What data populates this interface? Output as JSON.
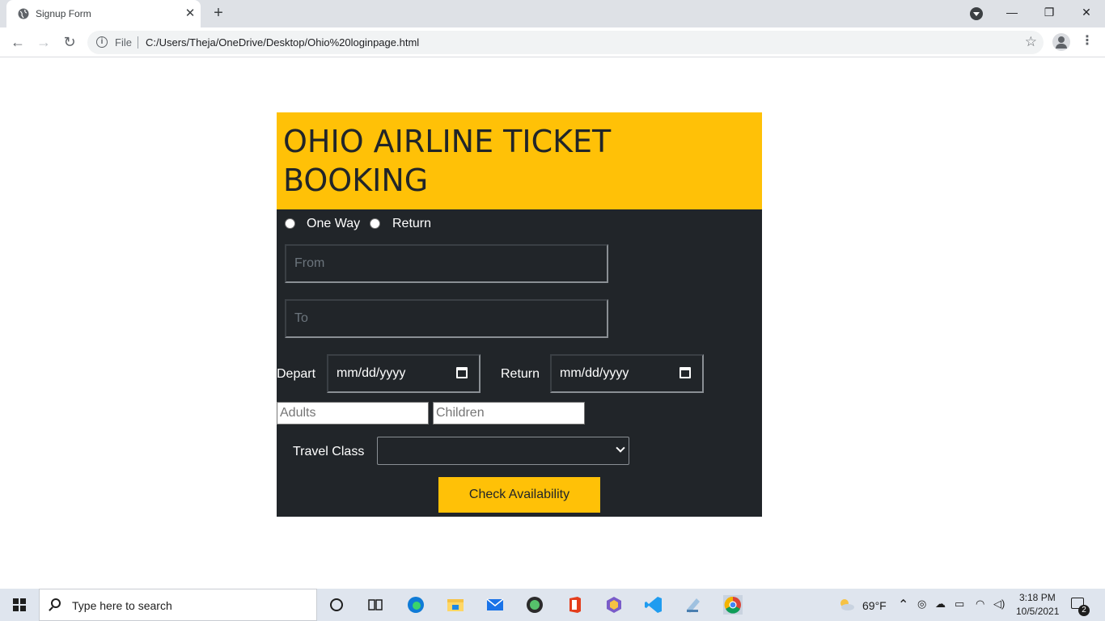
{
  "browser": {
    "tab_title": "Signup Form",
    "tab_close": "✕",
    "new_tab": "+",
    "minimize": "—",
    "restore": "❐",
    "close": "✕",
    "back": "←",
    "forward": "→",
    "reload": "↻",
    "info": "i",
    "file_label": "File",
    "url": "C:/Users/Theja/OneDrive/Desktop/Ohio%20loginpage.html",
    "star": "☆",
    "menu": "⋮"
  },
  "form": {
    "title": "OHIO AIRLINE TICKET BOOKING",
    "radio_one_way": "One Way",
    "radio_return": "Return",
    "from_placeholder": "From",
    "to_placeholder": "To",
    "depart_label": "Depart",
    "depart_value": "mm/dd/yyyy",
    "return_label": "Return",
    "return_value": "mm/dd/yyyy",
    "adults_placeholder": "Adults",
    "children_placeholder": "Children",
    "travel_class_label": "Travel Class",
    "travel_class_value": "",
    "submit_label": "Check Availability"
  },
  "taskbar": {
    "search_placeholder": "Type here to search",
    "weather": "69°F",
    "time": "3:18 PM",
    "date": "10/5/2021",
    "notification_count": "2"
  },
  "colors": {
    "accent": "#ffc107",
    "card_bg": "#212529"
  }
}
